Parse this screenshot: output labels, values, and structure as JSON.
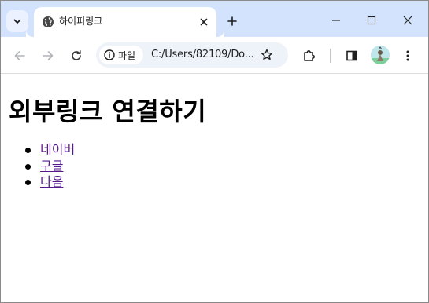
{
  "browser": {
    "tab": {
      "title": "하이퍼링크"
    },
    "omnibox": {
      "site_chip_label": "파일",
      "url": "C:/Users/82109/Do..."
    },
    "icons": {
      "tab_search": "chevron-down-icon",
      "favicon": "globe-icon",
      "tab_close": "close-icon",
      "new_tab": "plus-icon",
      "minimize": "minimize-icon",
      "maximize": "maximize-icon",
      "window_close": "close-icon",
      "back": "arrow-left-icon",
      "forward": "arrow-right-icon",
      "reload": "reload-icon",
      "info": "info-icon",
      "bookmark": "star-icon",
      "extensions": "puzzle-icon",
      "side_panel": "side-panel-icon",
      "menu": "kebab-menu-icon"
    },
    "colors": {
      "tabstrip_bg": "#d3e3fd",
      "omnibox_bg": "#eef2f9",
      "visited_link": "#551a8b"
    }
  },
  "page": {
    "heading": "외부링크 연결하기",
    "links": [
      {
        "label": "네이버"
      },
      {
        "label": "구글"
      },
      {
        "label": "다음"
      }
    ]
  }
}
